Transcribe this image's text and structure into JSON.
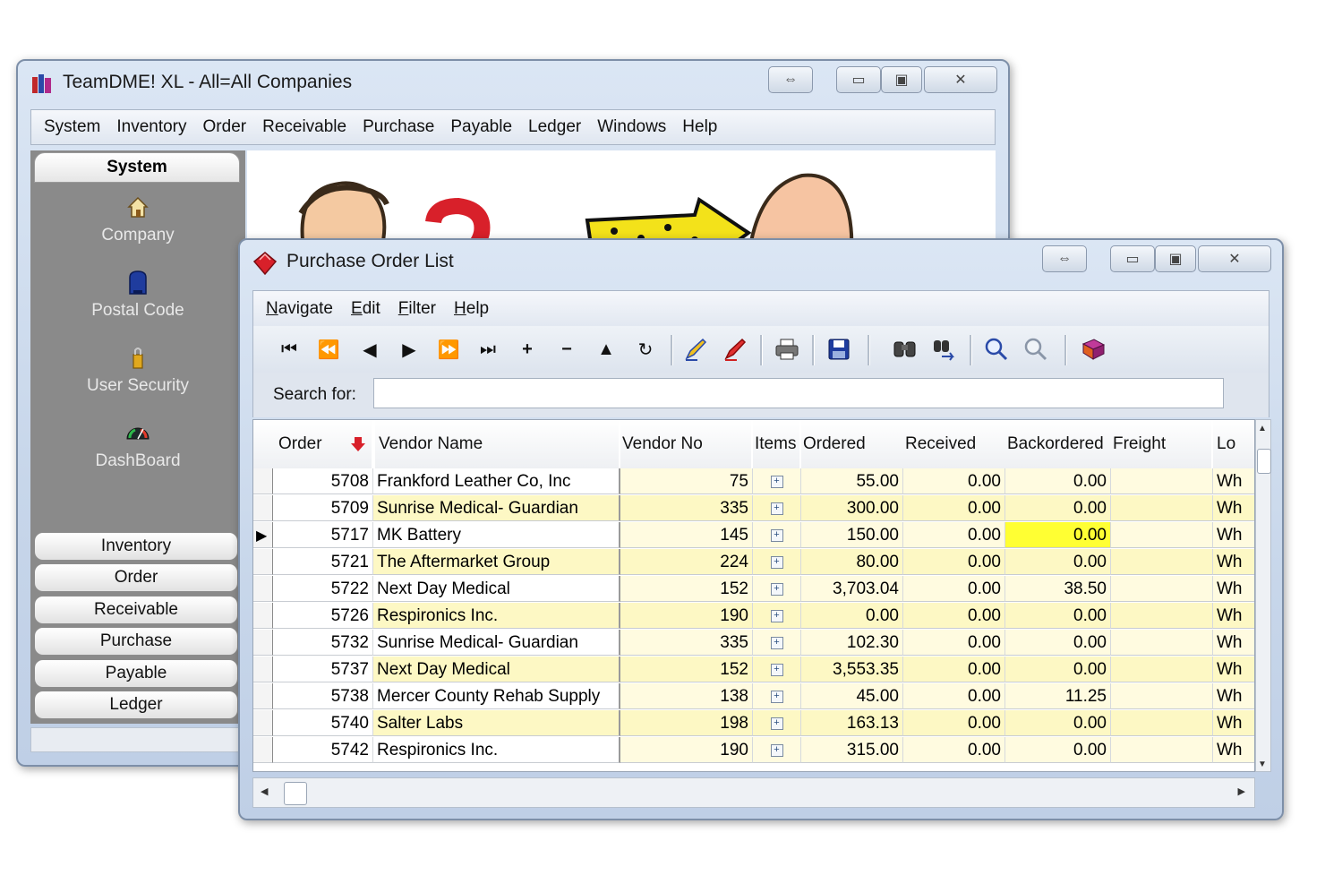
{
  "main_window": {
    "title": "TeamDME! XL - All=All Companies",
    "menu": [
      "System",
      "Inventory",
      "Order",
      "Receivable",
      "Purchase",
      "Payable",
      "Ledger",
      "Windows",
      "Help"
    ],
    "sidebar": {
      "header": "System",
      "items": [
        {
          "label": "Company",
          "icon": "house-icon"
        },
        {
          "label": "Postal Code",
          "icon": "mailbox-icon"
        },
        {
          "label": "User Security",
          "icon": "lock-icon"
        },
        {
          "label": "DashBoard",
          "icon": "gauge-icon"
        }
      ],
      "modules": [
        "Inventory",
        "Order",
        "Receivable",
        "Purchase",
        "Payable",
        "Ledger"
      ]
    }
  },
  "po_window": {
    "title": "Purchase Order List",
    "menu": [
      {
        "label": "Navigate",
        "accel": "N",
        "rest": "avigate"
      },
      {
        "label": "Edit",
        "accel": "E",
        "rest": "dit"
      },
      {
        "label": "Filter",
        "accel": "F",
        "rest": "ilter"
      },
      {
        "label": "Help",
        "accel": "H",
        "rest": "elp"
      }
    ],
    "toolbar": [
      "first-record-icon",
      "prior-page-icon",
      "prior-record-icon",
      "next-record-icon",
      "next-page-icon",
      "last-record-icon",
      "insert-icon",
      "delete-icon",
      "post-icon",
      "refresh-icon",
      "edit-pen-icon",
      "cancel-pen-icon",
      "print-icon",
      "save-icon",
      "binoculars-icon",
      "find-next-icon",
      "zoom-in-icon",
      "zoom-out-icon",
      "book-icon"
    ],
    "search": {
      "label": "Search for:",
      "value": ""
    },
    "columns": {
      "order": "Order",
      "vendor_name": "Vendor Name",
      "vendor_no": "Vendor No",
      "items": "Items",
      "ordered": "Ordered",
      "received": "Received",
      "backordered": "Backordered",
      "freight": "Freight",
      "loc": "Lo"
    },
    "rows": [
      {
        "order": "5708",
        "vendor": "Frankford Leather Co, Inc",
        "vendor_no": "75",
        "ordered": "55.00",
        "received": "0.00",
        "backordered": "0.00",
        "freight": "",
        "loc": "Wh"
      },
      {
        "order": "5709",
        "vendor": "Sunrise Medical- Guardian",
        "vendor_no": "335",
        "ordered": "300.00",
        "received": "0.00",
        "backordered": "0.00",
        "freight": "",
        "loc": "Wh"
      },
      {
        "order": "5717",
        "vendor": "MK Battery",
        "vendor_no": "145",
        "ordered": "150.00",
        "received": "0.00",
        "backordered": "0.00",
        "freight": "",
        "loc": "Wh"
      },
      {
        "order": "5721",
        "vendor": "The Aftermarket Group",
        "vendor_no": "224",
        "ordered": "80.00",
        "received": "0.00",
        "backordered": "0.00",
        "freight": "",
        "loc": "Wh"
      },
      {
        "order": "5722",
        "vendor": "Next Day Medical",
        "vendor_no": "152",
        "ordered": "3,703.04",
        "received": "0.00",
        "backordered": "38.50",
        "freight": "",
        "loc": "Wh"
      },
      {
        "order": "5726",
        "vendor": "Respironics Inc.",
        "vendor_no": "190",
        "ordered": "0.00",
        "received": "0.00",
        "backordered": "0.00",
        "freight": "",
        "loc": "Wh"
      },
      {
        "order": "5732",
        "vendor": "Sunrise Medical- Guardian",
        "vendor_no": "335",
        "ordered": "102.30",
        "received": "0.00",
        "backordered": "0.00",
        "freight": "",
        "loc": "Wh"
      },
      {
        "order": "5737",
        "vendor": "Next Day Medical",
        "vendor_no": "152",
        "ordered": "3,553.35",
        "received": "0.00",
        "backordered": "0.00",
        "freight": "",
        "loc": "Wh"
      },
      {
        "order": "5738",
        "vendor": "Mercer County Rehab Supply",
        "vendor_no": "138",
        "ordered": "45.00",
        "received": "0.00",
        "backordered": "11.25",
        "freight": "",
        "loc": "Wh"
      },
      {
        "order": "5740",
        "vendor": "Salter Labs",
        "vendor_no": "198",
        "ordered": "163.13",
        "received": "0.00",
        "backordered": "0.00",
        "freight": "",
        "loc": "Wh"
      },
      {
        "order": "5742",
        "vendor": "Respironics Inc.",
        "vendor_no": "190",
        "ordered": "315.00",
        "received": "0.00",
        "backordered": "0.00",
        "freight": "",
        "loc": "Wh"
      }
    ],
    "selected_row": 2,
    "colors": {
      "row_alt": "#fdf8c4",
      "row_plain": "#ffffff",
      "highlight_cell": "#ffff33",
      "title_icon": "#d8202a"
    }
  }
}
